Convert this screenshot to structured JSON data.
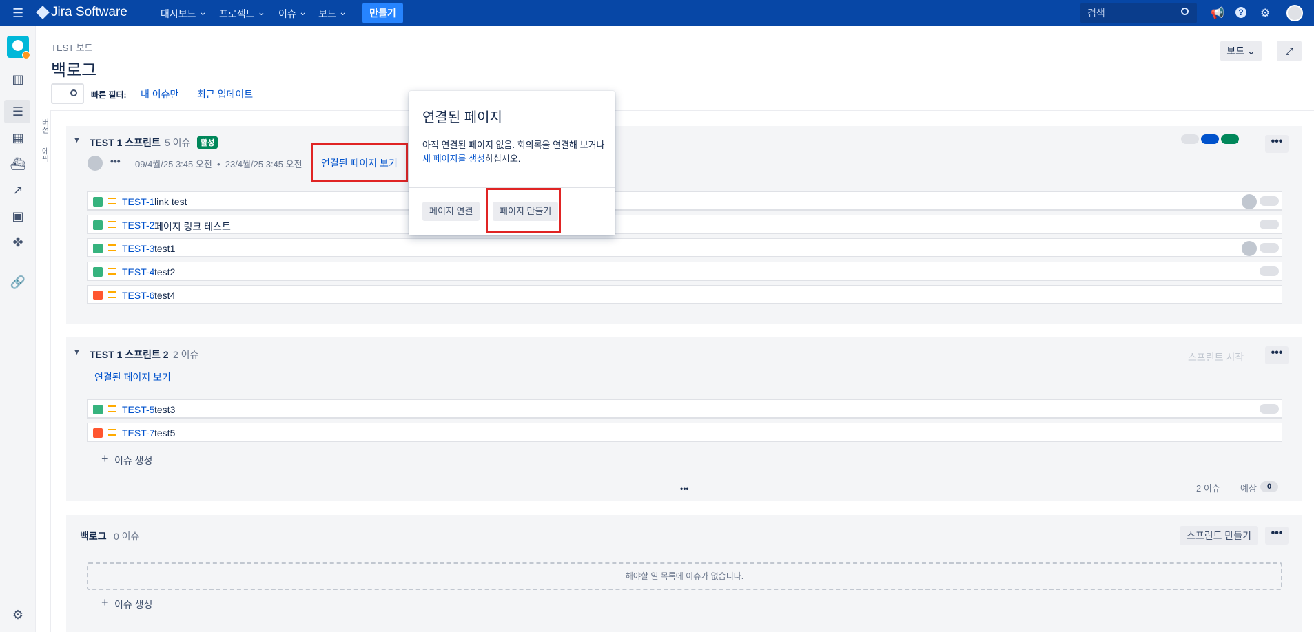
{
  "topnav": {
    "product": "Jira Software",
    "menu": [
      "대시보드",
      "프로젝트",
      "이슈",
      "보드"
    ],
    "create": "만들기",
    "search_placeholder": "검색"
  },
  "header": {
    "breadcrumb": "TEST 보드",
    "title": "백로그",
    "board_button": "보드",
    "quick_filter_label": "빠른 필터:",
    "filters": [
      "내 이슈만",
      "최근 업데이트"
    ]
  },
  "side_panel": {
    "tabs": [
      "버전",
      "에픽"
    ]
  },
  "sprint1": {
    "name": "TEST 1 스프린트",
    "count": "5 이슈",
    "badge": "활성",
    "dates": "09/4월/25 3:45 오전  •  23/4월/25 3:45 오전",
    "linked_pages": "연결된 페이지 보기",
    "issues": [
      {
        "key": "TEST-1",
        "summary": "link test",
        "type": "story",
        "avatar": true
      },
      {
        "key": "TEST-2",
        "summary": "페이지 링크 테스트",
        "type": "story",
        "avatar": false
      },
      {
        "key": "TEST-3",
        "summary": "test1",
        "type": "story",
        "avatar": true
      },
      {
        "key": "TEST-4",
        "summary": "test2",
        "type": "story",
        "avatar": false
      },
      {
        "key": "TEST-6",
        "summary": "test4",
        "type": "bug",
        "avatar": false
      }
    ]
  },
  "sprint2": {
    "name": "TEST 1 스프린트 2",
    "count": "2 이슈",
    "start": "스프린트 시작",
    "linked_pages": "연결된 페이지 보기",
    "issues": [
      {
        "key": "TEST-5",
        "summary": "test3",
        "type": "story"
      },
      {
        "key": "TEST-7",
        "summary": "test5",
        "type": "bug"
      }
    ],
    "create_issue": "이슈 생성",
    "footer_count": "2 이슈",
    "estimate_label": "예상",
    "estimate_value": "0"
  },
  "backlog": {
    "name": "백로그",
    "count": "0 이슈",
    "create_sprint": "스프린트 만들기",
    "empty": "해야할 일 목록에 이슈가 없습니다.",
    "create_issue": "이슈 생성"
  },
  "popup": {
    "title": "연결된 페이지",
    "text_before": "아직 연결된 페이지 없음. 회의록을 연결해 보거나 ",
    "link": "새 페이지를 생성",
    "text_after": "하십시오.",
    "link_page": "페이지 연결",
    "create_page": "페이지 만들기"
  },
  "colors": {
    "nav": "#0747a6",
    "link": "#0052cc",
    "active_badge": "#00875a",
    "highlight": "#e02424"
  }
}
